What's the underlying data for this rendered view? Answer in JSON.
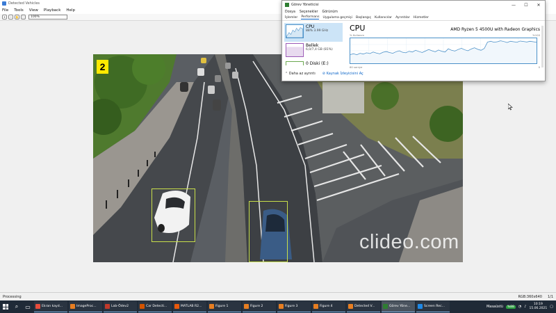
{
  "viewer": {
    "title": "Detected Vehicles",
    "menu": [
      "File",
      "Tools",
      "View",
      "Playback",
      "Help"
    ],
    "zoom_value": "100%",
    "frame_number": "2",
    "watermark": "clideo.com",
    "status_left": "Processing",
    "status_right": [
      "RGB:360x640",
      "1/1"
    ]
  },
  "task_manager": {
    "title": "Görev Yöneticisi",
    "controls": [
      "—",
      "☐",
      "✕"
    ],
    "menu": [
      "Dosya",
      "Seçenekler",
      "Görünüm"
    ],
    "tabs": [
      "İşlemler",
      "Performans",
      "Uygulama geçmişi",
      "Başlangıç",
      "Kullanıcılar",
      "Ayrıntılar",
      "Hizmetler"
    ],
    "selected_tab": "Performans",
    "resources": [
      {
        "name": "CPU",
        "detail": "88%  3.99 GHz"
      },
      {
        "name": "Bellek",
        "detail": "6,0/7,4 GB (81%)"
      },
      {
        "name": "0 Diski (E:)",
        "detail": ""
      }
    ],
    "cpu_heading": "CPU",
    "cpu_model": "AMD Ryzen 5 4500U with Radeon Graphics",
    "graph_top_left": "% Kullanım",
    "graph_top_right": "%100",
    "graph_bottom_left": "60 saniye",
    "graph_bottom_right": "0",
    "footer_less": "Daha az ayrıntı",
    "footer_link": "Kaynak İzleyicisini Aç",
    "cpu_usage_history": [
      35,
      38,
      34,
      40,
      37,
      42,
      39,
      45,
      41,
      38,
      44,
      47,
      43,
      40,
      46,
      50,
      44,
      42,
      48,
      45,
      52,
      47,
      43,
      49,
      55,
      50,
      46,
      53,
      48,
      45,
      58,
      52,
      49,
      55,
      60,
      54,
      50,
      57,
      62,
      56,
      52,
      59,
      85,
      88,
      84,
      86,
      90,
      87,
      83,
      88,
      86,
      84,
      89,
      87,
      85,
      88,
      86,
      84
    ]
  },
  "taskbar": {
    "tasks": [
      {
        "label": "Ekran kayd...",
        "color": "#e74c3c"
      },
      {
        "label": "ImageProc...",
        "color": "#e67e22"
      },
      {
        "label": "Lab-Ödev2",
        "color": "#c0392b"
      },
      {
        "label": "Car Detecti...",
        "color": "#d35400"
      },
      {
        "label": "MATLAB R2...",
        "color": "#e8590c"
      },
      {
        "label": "Figure 1",
        "color": "#e67e22"
      },
      {
        "label": "Figure 2",
        "color": "#e67e22"
      },
      {
        "label": "Figure 3",
        "color": "#e67e22"
      },
      {
        "label": "Figure 4",
        "color": "#e67e22"
      },
      {
        "label": "Detected V...",
        "color": "#e67e22"
      },
      {
        "label": "Görev Yöne...",
        "color": "#2e7d32"
      },
      {
        "label": "Screen Rec...",
        "color": "#1e88e5"
      }
    ],
    "tray_label": "Masaüstü",
    "battery": "%88",
    "time": "10:19",
    "date": "15.06.2021"
  },
  "colors": {
    "badge": "#ffea00",
    "bbox": "#c9e04a",
    "taskbar": "#1f2a37",
    "cpu_graph": "#4a90c8"
  }
}
